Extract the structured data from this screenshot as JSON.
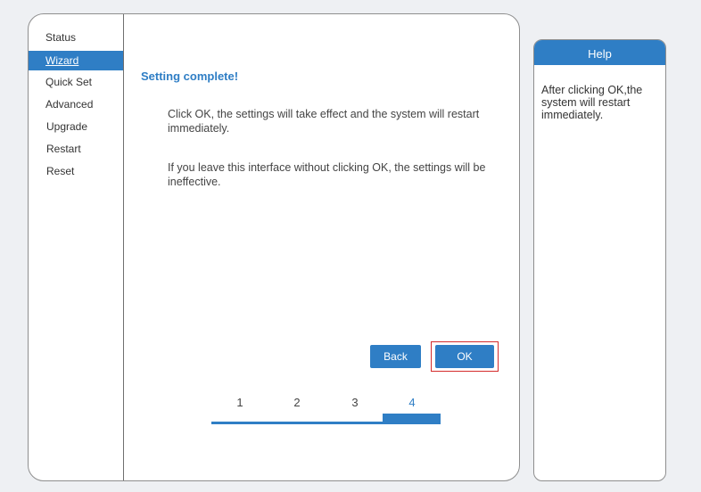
{
  "nav": {
    "items": [
      {
        "label": "Status"
      },
      {
        "label": "Wizard"
      },
      {
        "label": "Quick Set"
      },
      {
        "label": "Advanced"
      },
      {
        "label": "Upgrade"
      },
      {
        "label": "Restart"
      },
      {
        "label": "Reset"
      }
    ],
    "active": "Wizard"
  },
  "main": {
    "title": "Setting complete!",
    "paragraph_1": "Click OK, the settings will take effect and the system will restart immediately.",
    "paragraph_2": "If you leave this interface without clicking OK, the settings will be ineffective.",
    "back_label": "Back",
    "ok_label": "OK"
  },
  "steps": {
    "labels": [
      "1",
      "2",
      "3",
      "4"
    ],
    "current": 4
  },
  "help": {
    "header": "Help",
    "text": "After clicking OK,the system will restart immediately."
  },
  "colors": {
    "accent": "#2f7ec5",
    "highlight_frame": "#d42b2b",
    "background": "#eef0f3"
  }
}
